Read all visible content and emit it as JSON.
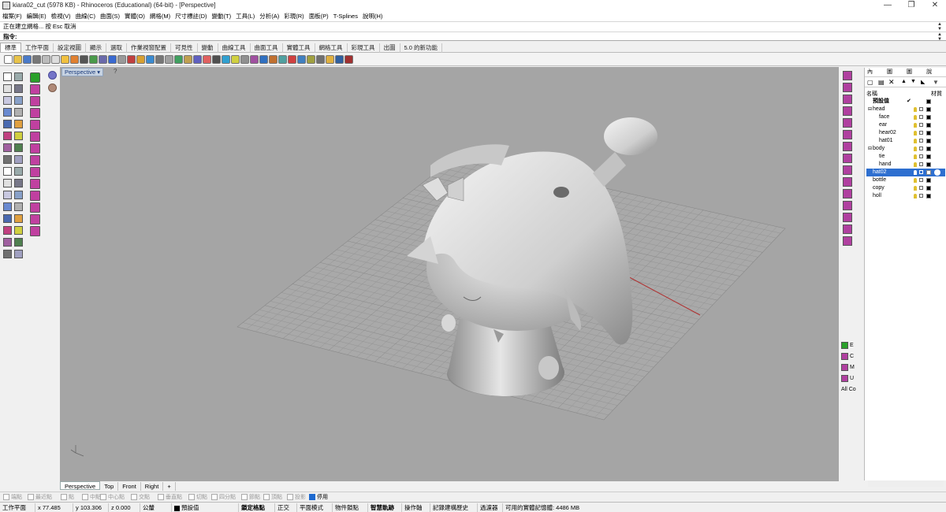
{
  "window": {
    "title": "kiara02_cut (5978 KB) - Rhinoceros (Educational) (64-bit) - [Perspective]",
    "min": "—",
    "max": "❐",
    "close": "✕"
  },
  "menu": [
    "檔案(F)",
    "編輯(E)",
    "檢視(V)",
    "曲線(C)",
    "曲面(S)",
    "實體(O)",
    "網格(M)",
    "尺寸標註(D)",
    "變動(T)",
    "工具(L)",
    "分析(A)",
    "彩現(R)",
    "面板(P)",
    "T-Splines",
    "說明(H)"
  ],
  "command": {
    "history": "正在建立網格... 按 Esc 取消",
    "prompt": "指令:"
  },
  "tabs": [
    "標準",
    "工作平面",
    "設定視圖",
    "顯示",
    "選取",
    "作業視窗配置",
    "可見性",
    "變動",
    "曲線工具",
    "曲面工具",
    "實體工具",
    "網格工具",
    "彩現工具",
    "出圖",
    "5.0 的新功能"
  ],
  "viewport": {
    "name": "Perspective",
    "menu_arrow": "▾",
    "axes_label": "y x z"
  },
  "view_tabs": [
    "Perspective",
    "Top",
    "Front",
    "Right",
    "+"
  ],
  "panel": {
    "tabs": [
      "內",
      "圖",
      "圖",
      "說"
    ],
    "header_name": "名稱",
    "header_mat": "材質",
    "layers": [
      {
        "name": "預設值",
        "indent": 0,
        "bold": true,
        "check": "✔"
      },
      {
        "name": "head",
        "indent": 0,
        "expander": "⊟"
      },
      {
        "name": "face",
        "indent": 1
      },
      {
        "name": "ear",
        "indent": 1
      },
      {
        "name": "hear02",
        "indent": 1
      },
      {
        "name": "hat01",
        "indent": 1
      },
      {
        "name": "body",
        "indent": 0,
        "expander": "⊟"
      },
      {
        "name": "tie",
        "indent": 1
      },
      {
        "name": "hand",
        "indent": 1
      },
      {
        "name": "hat02",
        "indent": 0,
        "selected": true
      },
      {
        "name": "bottle",
        "indent": 0
      },
      {
        "name": "copy",
        "indent": 0
      },
      {
        "name": "holl",
        "indent": 0
      }
    ]
  },
  "right_tools_labels": [
    "E",
    "C",
    "M",
    "U",
    "All Co"
  ],
  "osnap": [
    "端點",
    "最近點",
    "點",
    "中點",
    "中心點",
    "交點",
    "垂直點",
    "切點",
    "四分點",
    "節點",
    "頂點",
    "投影",
    "停用"
  ],
  "status": {
    "cplane": "工作平面",
    "x": "x 77.485",
    "y": "y 103.306",
    "z": "z 0.000",
    "units": "公釐",
    "layer": "預設值",
    "grid_snap": "鎖定格點",
    "ortho": "正交",
    "planar": "平面模式",
    "osnap": "物件鎖點",
    "smarttrack": "智慧軌跡",
    "gumball": "操作軸",
    "history": "記錄建構歷史",
    "filter": "過濾器",
    "memory": "可用的實體記憶體: 4486 MB"
  }
}
